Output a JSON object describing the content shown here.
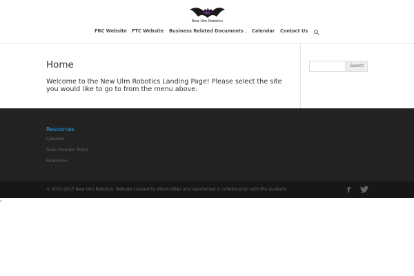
{
  "header": {
    "logo_text": "New Ulm Robotics",
    "nav": [
      {
        "label": "FRC Website"
      },
      {
        "label": "FTC Website"
      },
      {
        "label": "Business Related Documents"
      },
      {
        "label": "Calendar"
      },
      {
        "label": "Contact Us"
      }
    ]
  },
  "main": {
    "title": "Home",
    "welcome": "Welcome to the New Ulm Robotics Landing Page! Please select the site you would like to go to from the menu above."
  },
  "sidebar": {
    "search_placeholder": "",
    "search_button": "Search"
  },
  "footer": {
    "heading": "Resources",
    "links": [
      "Calendar",
      "Team Member Portal",
      "RoboTime!"
    ]
  },
  "bottom": {
    "copyright": "© 2012-2017 New Ulm Robotics. Website created by Adam Miller and maintained in collaboration with the students."
  },
  "icons": {
    "logo": "bat-logo-icon",
    "search": "search-icon",
    "facebook": "facebook-icon",
    "twitter": "twitter-icon"
  },
  "colors": {
    "accent": "#2ea3f2",
    "logo_purple": "#6a2c8f",
    "footer_bg": "#222222",
    "bottom_bg": "#171717"
  }
}
